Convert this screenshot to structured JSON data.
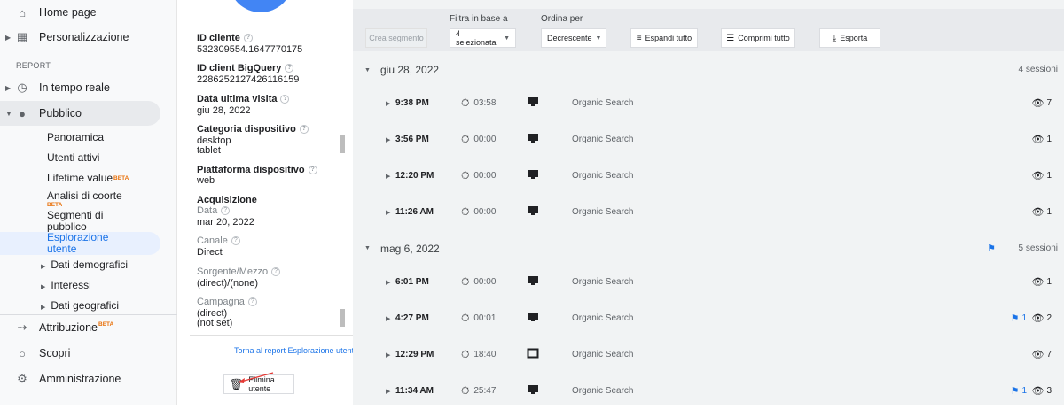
{
  "sidebar": {
    "home": "Home page",
    "personalizzazione": "Personalizzazione",
    "section": "REPORT",
    "realtime": "In tempo reale",
    "pubblico": "Pubblico",
    "sub": {
      "panoramica": "Panoramica",
      "utenti_attivi": "Utenti attivi",
      "lifetime": "Lifetime value",
      "coorte": "Analisi di coorte",
      "segmenti_1": "Segmenti di",
      "segmenti_2": "pubblico",
      "esplorazione_1": "Esplorazione",
      "esplorazione_2": "utente",
      "demografici": "Dati demografici",
      "interessi": "Interessi",
      "geografici": "Dati geografici"
    },
    "beta": "BETA",
    "attribuzione": "Attribuzione",
    "scopri": "Scopri",
    "amministrazione": "Amministrazione"
  },
  "panel": {
    "id_cliente_label": "ID cliente",
    "id_cliente": "532309554.1647770175",
    "bq_label": "ID client BigQuery",
    "bq": "2286252127426116159",
    "ultima_label": "Data ultima visita",
    "ultima": "giu 28, 2022",
    "categoria_label": "Categoria dispositivo",
    "categoria_1": "desktop",
    "categoria_2": "tablet",
    "piattaforma_label": "Piattaforma dispositivo",
    "piattaforma": "web",
    "acquisizione": "Acquisizione",
    "data_label": "Data",
    "data": "mar 20, 2022",
    "canale_label": "Canale",
    "canale": "Direct",
    "sorgente_label": "Sorgente/Mezzo",
    "sorgente": "(direct)/(none)",
    "campagna_label": "Campagna",
    "campagna_1": "(direct)",
    "campagna_2": "(not set)",
    "torna": "Torna al report Esplorazione utente",
    "elimina": "Elimina utente"
  },
  "toolbar": {
    "crea": "Crea segmento",
    "filtra_label": "Filtra in base a",
    "filtra_value": "4 selezionata",
    "ordina_label": "Ordina per",
    "ordina_value": "Decrescente",
    "espandi": "Espandi tutto",
    "comprimi": "Comprimi tutto",
    "esporta": "Esporta"
  },
  "groups": [
    {
      "date": "giu 28, 2022",
      "sessions": "4 sessioni"
    },
    {
      "date": "mag 6, 2022",
      "sessions": "5 sessioni"
    }
  ],
  "rows": [
    {
      "time": "9:38 PM",
      "duration": "03:58",
      "source": "Organic Search",
      "views": "7",
      "flags": ""
    },
    {
      "time": "3:56 PM",
      "duration": "00:00",
      "source": "Organic Search",
      "views": "1",
      "flags": ""
    },
    {
      "time": "12:20 PM",
      "duration": "00:00",
      "source": "Organic Search",
      "views": "1",
      "flags": ""
    },
    {
      "time": "11:26 AM",
      "duration": "00:00",
      "source": "Organic Search",
      "views": "1",
      "flags": ""
    },
    {
      "time": "6:01 PM",
      "duration": "00:00",
      "source": "Organic Search",
      "views": "1",
      "flags": ""
    },
    {
      "time": "4:27 PM",
      "duration": "00:01",
      "source": "Organic Search",
      "views": "2",
      "flags": "1"
    },
    {
      "time": "12:29 PM",
      "duration": "18:40",
      "source": "Organic Search",
      "views": "7",
      "flags": ""
    },
    {
      "time": "11:34 AM",
      "duration": "25:47",
      "source": "Organic Search",
      "views": "3",
      "flags": "1"
    }
  ],
  "colors": {
    "accent": "#1a73e8",
    "beta": "#e8710a",
    "active_bg": "#e8f0fe"
  }
}
